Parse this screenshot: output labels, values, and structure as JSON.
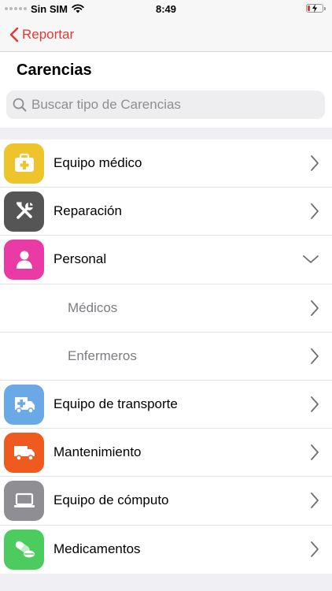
{
  "status_bar": {
    "carrier": "Sin SIM",
    "time": "8:49",
    "battery_level": 0.15,
    "battery_color": "#e53935"
  },
  "nav": {
    "back_label": "Reportar",
    "accent": "#e53935"
  },
  "header": {
    "title": "Carencias"
  },
  "search": {
    "placeholder": "Buscar tipo de Carencias",
    "value": ""
  },
  "rows": [
    {
      "label": "Equipo médico",
      "icon": "medical-kit-icon",
      "color": "#eec42d",
      "expanded": false
    },
    {
      "label": "Reparación",
      "icon": "tools-icon",
      "color": "#555555",
      "expanded": false
    },
    {
      "label": "Personal",
      "icon": "person-icon",
      "color": "#e93aa6",
      "expanded": true
    },
    {
      "label": "Médicos",
      "sub": true
    },
    {
      "label": "Enfermeros",
      "sub": true
    },
    {
      "label": "Equipo de transporte",
      "icon": "ambulance-icon",
      "color": "#6aa8e6",
      "expanded": false
    },
    {
      "label": "Mantenimiento",
      "icon": "truck-icon",
      "color": "#ef5a1e",
      "expanded": false
    },
    {
      "label": "Equipo de cómputo",
      "icon": "laptop-icon",
      "color": "#8e8e93",
      "expanded": false
    },
    {
      "label": "Medicamentos",
      "icon": "pill-icon",
      "color": "#4ccc5e",
      "expanded": false
    }
  ]
}
